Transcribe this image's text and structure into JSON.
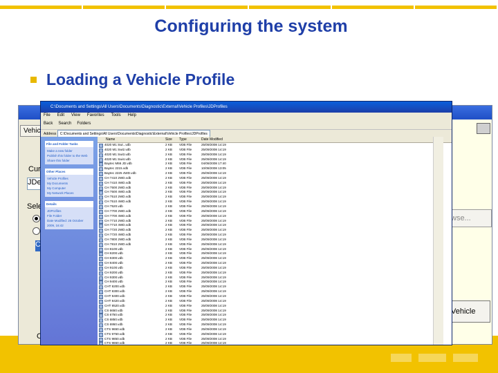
{
  "slide": {
    "title": "Configuring the system",
    "bullet": "Loading a Vehicle Profile",
    "top_rule_colors": [
      "#f2c200",
      "#f2c200",
      "#f2c200",
      "#f2c200",
      "#f2c200",
      "#f2c200"
    ],
    "accent": "#1f3fa8",
    "band": "#f2c200"
  },
  "bg_app": {
    "tab": "Vehicle P",
    "current_label": "Curre",
    "current_value": "JDee",
    "select_label": "Selec",
    "selected_item": "CA",
    "browse_label": "wse...",
    "vehicle_button": "Vehicle",
    "ok_button": "O"
  },
  "explorer": {
    "title": "C:\\Documents and Settings\\All Users\\Documents\\Diagnostic\\External\\Vehicle Profiles\\JDProfiles",
    "menu": [
      "File",
      "Edit",
      "View",
      "Favorites",
      "Tools",
      "Help"
    ],
    "toolbar": [
      "Back",
      "Search",
      "Folders"
    ],
    "address_label": "Address",
    "address": "C:\\Documents and Settings\\All Users\\Documents\\Diagnostic\\External\\Vehicle Profiles\\JDProfiles",
    "tasks": [
      {
        "header": "File and Folder Tasks",
        "items": [
          "Make a new folder",
          "Publish this folder to the Web",
          "Share this folder"
        ]
      },
      {
        "header": "Other Places",
        "items": [
          "Vehicle Profiles",
          "My Documents",
          "My Computer",
          "My Network Places"
        ]
      },
      {
        "header": "Details",
        "items": [
          "JDProfiles",
          "File Folder",
          "Date Modified: 25 October",
          "2009, 16:42"
        ]
      }
    ],
    "columns": [
      "Name",
      "Size",
      "Type",
      "Date Modified"
    ],
    "files": [
      {
        "name": "4020 M1 Swi...vdb",
        "size": "2 KB",
        "type": "VDB File",
        "date": "25/09/2008 14:19"
      },
      {
        "name": "4020 M1 Swi2.vdb",
        "size": "2 KB",
        "type": "VDB File",
        "date": "25/09/2008 14:19"
      },
      {
        "name": "4020 M1 Swi3.vdb",
        "size": "2 KB",
        "type": "VDB File",
        "date": "25/09/2008 14:19"
      },
      {
        "name": "4020 M1 Swi4.vdb",
        "size": "2 KB",
        "type": "VDB File",
        "date": "25/09/2008 14:19"
      },
      {
        "name": "Baytec M66 JD.vdb",
        "size": "2 KB",
        "type": "VDB File",
        "date": "04/08/2008 17:40"
      },
      {
        "name": "Baytec 2215.vdb",
        "size": "2 KB",
        "type": "VDB File",
        "date": "10/08/2008 13:05"
      },
      {
        "name": "Baytec 2225 4WD.vdb",
        "size": "2 KB",
        "type": "VDB File",
        "date": "25/09/2008 14:19"
      },
      {
        "name": "CH 7410 2WD.vdb",
        "size": "2 KB",
        "type": "VDB File",
        "date": "25/09/2008 14:19"
      },
      {
        "name": "CH 7410 4WD.vdb",
        "size": "2 KB",
        "type": "VDB File",
        "date": "25/09/2008 14:19"
      },
      {
        "name": "CH 7500 2WD.vdb",
        "size": "2 KB",
        "type": "VDB File",
        "date": "25/09/2008 14:19"
      },
      {
        "name": "CH 7500 4WD.vdb",
        "size": "2 KB",
        "type": "VDB File",
        "date": "25/09/2008 14:19"
      },
      {
        "name": "CH 7510 2WD.vdb",
        "size": "2 KB",
        "type": "VDB File",
        "date": "25/09/2008 14:19"
      },
      {
        "name": "CH 7510 4WD.vdb",
        "size": "2 KB",
        "type": "VDB File",
        "date": "25/09/2008 14:19"
      },
      {
        "name": "CH 7520.vdb",
        "size": "2 KB",
        "type": "VDB File",
        "date": "25/09/2008 14:19"
      },
      {
        "name": "CH 7700 2WD.vdb",
        "size": "2 KB",
        "type": "VDB File",
        "date": "25/09/2008 14:19"
      },
      {
        "name": "CH 7700 4WD.vdb",
        "size": "2 KB",
        "type": "VDB File",
        "date": "25/09/2008 14:19"
      },
      {
        "name": "CH 7710 2WD.vdb",
        "size": "2 KB",
        "type": "VDB File",
        "date": "25/09/2008 14:19"
      },
      {
        "name": "CH 7710 4WD.vdb",
        "size": "2 KB",
        "type": "VDB File",
        "date": "25/09/2008 14:19"
      },
      {
        "name": "CH 7720 2WD.vdb",
        "size": "2 KB",
        "type": "VDB File",
        "date": "25/09/2008 14:19"
      },
      {
        "name": "CH 7720 4WD.vdb",
        "size": "2 KB",
        "type": "VDB File",
        "date": "25/09/2008 14:19"
      },
      {
        "name": "CH 7800 2WD.vdb",
        "size": "2 KB",
        "type": "VDB File",
        "date": "25/09/2008 14:19"
      },
      {
        "name": "CH 7810 2WD.vdb",
        "size": "2 KB",
        "type": "VDB File",
        "date": "25/09/2008 14:19"
      },
      {
        "name": "CH 8100.vdb",
        "size": "2 KB",
        "type": "VDB File",
        "date": "25/09/2008 14:19"
      },
      {
        "name": "CH 8200.vdb",
        "size": "2 KB",
        "type": "VDB File",
        "date": "25/09/2008 14:19"
      },
      {
        "name": "CH 8300.vdb",
        "size": "2 KB",
        "type": "VDB File",
        "date": "25/09/2008 14:19"
      },
      {
        "name": "CH 8400.vdb",
        "size": "2 KB",
        "type": "VDB File",
        "date": "25/09/2008 14:19"
      },
      {
        "name": "CH 9100.vdb",
        "size": "2 KB",
        "type": "VDB File",
        "date": "25/09/2008 14:19"
      },
      {
        "name": "CH 9200.vdb",
        "size": "2 KB",
        "type": "VDB File",
        "date": "25/09/2008 14:19"
      },
      {
        "name": "CH 9300.vdb",
        "size": "2 KB",
        "type": "VDB File",
        "date": "25/09/2008 14:19"
      },
      {
        "name": "CH 9400.vdb",
        "size": "2 KB",
        "type": "VDB File",
        "date": "25/09/2008 14:19"
      },
      {
        "name": "CHT 8200.vdb",
        "size": "2 KB",
        "type": "VDB File",
        "date": "25/09/2008 14:19"
      },
      {
        "name": "CHT 8300.vdb",
        "size": "2 KB",
        "type": "VDB File",
        "date": "25/09/2008 14:19"
      },
      {
        "name": "CHT 8400.vdb",
        "size": "2 KB",
        "type": "VDB File",
        "date": "25/09/2008 14:19"
      },
      {
        "name": "CHT 8420.vdb",
        "size": "2 KB",
        "type": "VDB File",
        "date": "25/09/2008 14:19"
      },
      {
        "name": "CHT 8520.vdb",
        "size": "2 KB",
        "type": "VDB File",
        "date": "25/09/2008 14:19"
      },
      {
        "name": "CS 6650.vdb",
        "size": "2 KB",
        "type": "VDB File",
        "date": "25/09/2008 14:19"
      },
      {
        "name": "CS 6750.vdb",
        "size": "2 KB",
        "type": "VDB File",
        "date": "25/09/2008 14:19"
      },
      {
        "name": "CS 6850.vdb",
        "size": "2 KB",
        "type": "VDB File",
        "date": "25/09/2008 14:19"
      },
      {
        "name": "CS 6950.vdb",
        "size": "2 KB",
        "type": "VDB File",
        "date": "25/09/2008 14:19"
      },
      {
        "name": "CTS 9650.vdb",
        "size": "2 KB",
        "type": "VDB File",
        "date": "25/09/2008 14:19"
      },
      {
        "name": "CTS 9750.vdb",
        "size": "2 KB",
        "type": "VDB File",
        "date": "25/09/2008 14:19"
      },
      {
        "name": "CTS 9850.vdb",
        "size": "2 KB",
        "type": "VDB File",
        "date": "25/09/2008 14:19"
      },
      {
        "name": "CTS 9860.vdb",
        "size": "2 KB",
        "type": "VDB File",
        "date": "25/09/2008 14:19"
      },
      {
        "name": "CTS 9870.vdb",
        "size": "2 KB",
        "type": "VDB File",
        "date": "25/09/2008 14:19"
      }
    ]
  }
}
